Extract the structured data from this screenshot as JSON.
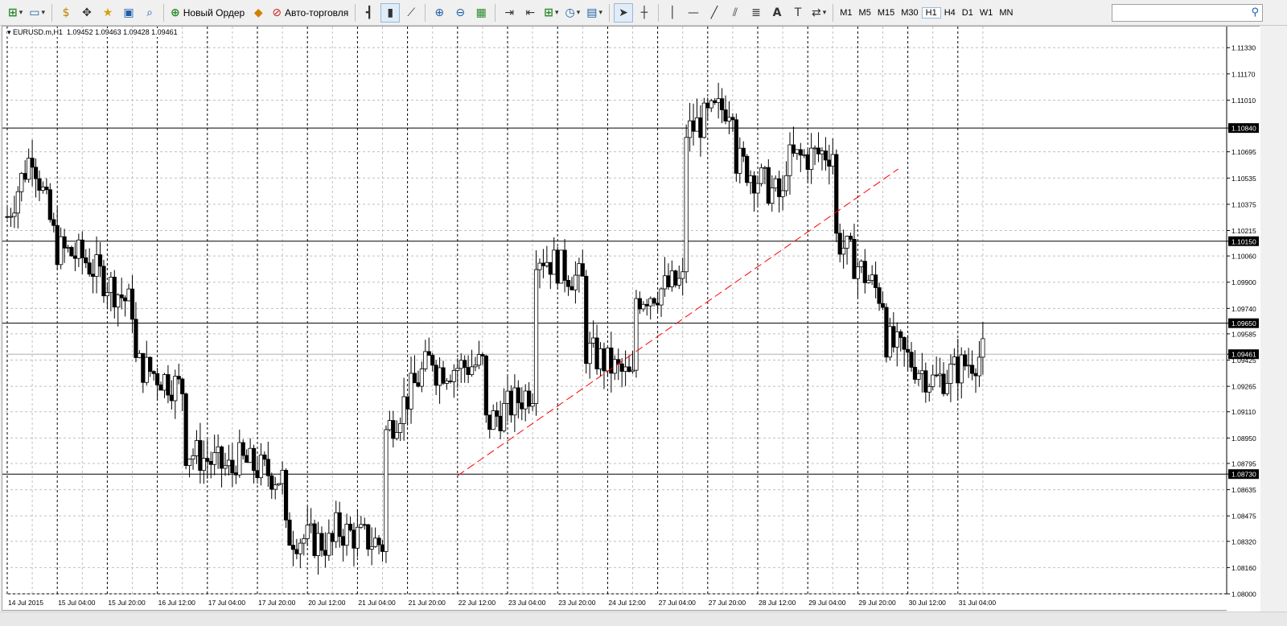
{
  "toolbar": {
    "new_order_label": "Новый Ордер",
    "auto_trading_label": "Авто-торговля",
    "timeframes": [
      "M1",
      "M5",
      "M15",
      "M30",
      "H1",
      "H4",
      "D1",
      "W1",
      "MN"
    ],
    "active_timeframe": "H1",
    "search_placeholder": ""
  },
  "chart": {
    "title": "EURUSD.m,H1  1.09452 1.09463 1.09428 1.09461",
    "price_levels": [
      "1.11330",
      "1.11170",
      "1.11010",
      "1.10840",
      "1.10695",
      "1.10535",
      "1.10375",
      "1.10215",
      "1.10150",
      "1.10060",
      "1.09900",
      "1.09740",
      "1.09650",
      "1.09585",
      "1.09461",
      "1.09425",
      "1.09265",
      "1.09110",
      "1.08950",
      "1.08795",
      "1.08730",
      "1.08635",
      "1.08475",
      "1.08320",
      "1.08160",
      "1.08000"
    ],
    "highlighted_levels": [
      "1.10840",
      "1.10150",
      "1.09650",
      "1.09461",
      "1.08730"
    ],
    "time_labels": [
      "14 Jul 2015",
      "15 Jul 04:00",
      "15 Jul 20:00",
      "16 Jul 12:00",
      "17 Jul 04:00",
      "17 Jul 20:00",
      "20 Jul 12:00",
      "21 Jul 04:00",
      "21 Jul 20:00",
      "22 Jul 12:00",
      "23 Jul 04:00",
      "23 Jul 20:00",
      "24 Jul 12:00",
      "27 Jul 04:00",
      "27 Jul 20:00",
      "28 Jul 12:00",
      "29 Jul 04:00",
      "29 Jul 20:00",
      "30 Jul 12:00",
      "31 Jul 04:00"
    ],
    "colors": {
      "candle": "#000000",
      "grid": "#c0c0c0",
      "trendline": "#ff0000",
      "level_line": "#000000"
    }
  },
  "chart_data": {
    "type": "candlestick",
    "symbol": "EURUSD.m",
    "timeframe": "H1",
    "last_bar": {
      "open": 1.09452,
      "high": 1.09463,
      "low": 1.09428,
      "close": 1.09461
    },
    "ylim": [
      1.08,
      1.1139
    ],
    "horizontal_levels": [
      1.1084,
      1.1015,
      1.0965,
      1.0873
    ],
    "trendline": {
      "start": {
        "time": "22 Jul 12:00",
        "price": 1.0872
      },
      "end": {
        "time": "30 Jul 12:00",
        "price": 1.1059
      }
    },
    "close_path": [
      [
        "14 Jul 2015",
        1.103
      ],
      [
        "14 Jul 2015",
        1.107
      ],
      [
        "15 Jul 04:00",
        1.101
      ],
      [
        "15 Jul 04:00",
        1.1005
      ],
      [
        "15 Jul 04:00",
        1.102
      ],
      [
        "15 Jul 20:00",
        1.0975
      ],
      [
        "15 Jul 20:00",
        1.095
      ],
      [
        "16 Jul 12:00",
        1.0925
      ],
      [
        "16 Jul 12:00",
        1.0895
      ],
      [
        "17 Jul 04:00",
        1.0875
      ],
      [
        "17 Jul 04:00",
        1.089
      ],
      [
        "17 Jul 20:00",
        1.087
      ],
      [
        "17 Jul 20:00",
        1.084
      ],
      [
        "20 Jul 12:00",
        1.083
      ],
      [
        "20 Jul 12:00",
        1.0845
      ],
      [
        "21 Jul 04:00",
        1.083
      ],
      [
        "21 Jul 04:00",
        1.087
      ],
      [
        "21 Jul 20:00",
        1.0945
      ],
      [
        "21 Jul 20:00",
        1.0935
      ],
      [
        "22 Jul 12:00",
        1.094
      ],
      [
        "22 Jul 12:00",
        1.089
      ],
      [
        "23 Jul 04:00",
        1.0925
      ],
      [
        "23 Jul 04:00",
        1.102
      ],
      [
        "23 Jul 20:00",
        1.099
      ],
      [
        "23 Jul 20:00",
        1.096
      ],
      [
        "24 Jul 12:00",
        1.093
      ],
      [
        "24 Jul 12:00",
        1.0975
      ],
      [
        "27 Jul 04:00",
        1.099
      ],
      [
        "27 Jul 04:00",
        1.107
      ],
      [
        "27 Jul 20:00",
        1.11
      ],
      [
        "27 Jul 20:00",
        1.108
      ],
      [
        "28 Jul 12:00",
        1.104
      ],
      [
        "28 Jul 12:00",
        1.106
      ],
      [
        "29 Jul 04:00",
        1.107
      ],
      [
        "29 Jul 04:00",
        1.104
      ],
      [
        "29 Jul 20:00",
        1.098
      ],
      [
        "29 Jul 20:00",
        1.097
      ],
      [
        "30 Jul 12:00",
        1.093
      ],
      [
        "30 Jul 12:00",
        1.092
      ],
      [
        "31 Jul 04:00",
        1.0946
      ]
    ]
  }
}
